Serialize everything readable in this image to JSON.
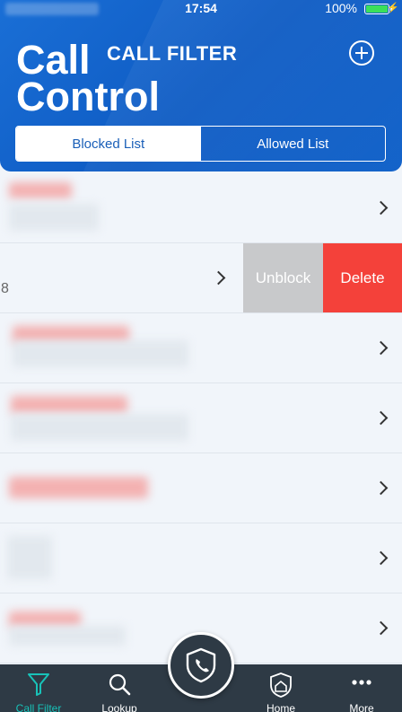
{
  "status_bar": {
    "time": "17:54",
    "battery": "100%",
    "charging_icon": "bolt-icon"
  },
  "header": {
    "app_title": "Call Control",
    "section_title": "CALL FILTER",
    "add_icon": "plus-circle-icon"
  },
  "segments": {
    "active": "Blocked List",
    "inactive": "Allowed List"
  },
  "list": {
    "swiped_row": {
      "number_fragment": "8",
      "unblock_label": "Unblock",
      "delete_label": "Delete"
    }
  },
  "tabbar": {
    "tabs": [
      {
        "label": "Call Filter",
        "icon": "filter-icon",
        "active": true
      },
      {
        "label": "Lookup",
        "icon": "search-icon",
        "active": false
      },
      {
        "label": "Home",
        "icon": "home-shield-icon",
        "active": false
      },
      {
        "label": "More",
        "icon": "more-icon",
        "active": false
      }
    ],
    "center_icon": "shield-phone-icon"
  },
  "colors": {
    "accent": "#18c2b8",
    "header_blue": "#1565c8",
    "delete_red": "#f4413a",
    "unblock_gray": "#c8c9cb"
  }
}
